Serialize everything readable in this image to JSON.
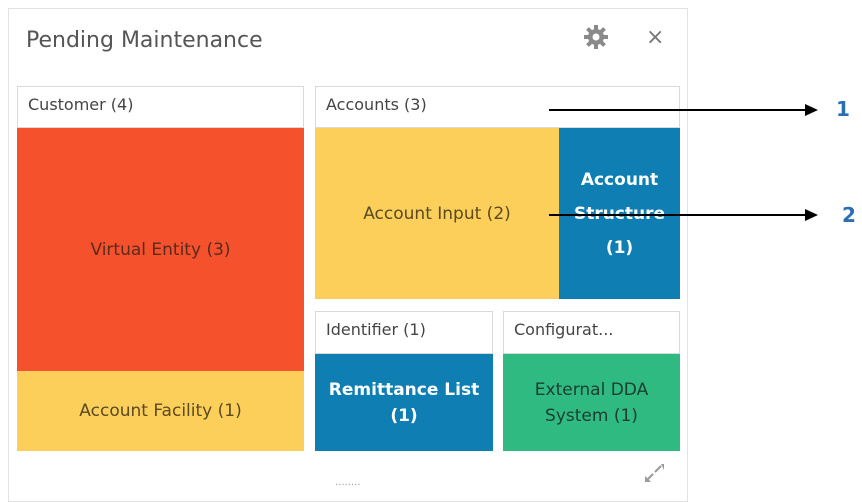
{
  "widget": {
    "title": "Pending Maintenance",
    "icons": {
      "settings": "gear-icon",
      "close": "close-icon",
      "expand": "expand-icon"
    },
    "close_glyph": "×",
    "grip_glyph": "........"
  },
  "groups": {
    "customer": {
      "label": "Customer (4)",
      "tiles": {
        "virtual_entity": "Virtual Entity (3)",
        "account_facility": "Account Facility (1)"
      }
    },
    "accounts": {
      "label": "Accounts (3)",
      "tiles": {
        "account_input": "Account Input (2)",
        "account_structure_line1": "Account",
        "account_structure_line2": "Structure",
        "account_structure_line3": "(1)"
      }
    },
    "identifier": {
      "label": "Identifier (1)",
      "tiles": {
        "remittance_line1": "Remittance List",
        "remittance_line2": "(1)"
      }
    },
    "configuration": {
      "label": "Configurat...",
      "tiles": {
        "external_line1": "External DDA",
        "external_line2": "System (1)"
      }
    }
  },
  "callouts": {
    "one": "1",
    "two": "2"
  },
  "colors": {
    "red": "#f4512c",
    "yellow": "#fbcf5a",
    "blue": "#0f7fb3",
    "green": "#2fba81",
    "callout": "#2a6fb6"
  }
}
